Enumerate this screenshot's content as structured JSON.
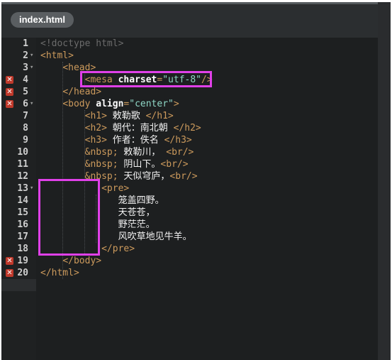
{
  "tab": {
    "label": "index.html"
  },
  "lines": [
    {
      "num": "1",
      "fold": "",
      "error": false
    },
    {
      "num": "2",
      "fold": "▾",
      "error": false
    },
    {
      "num": "3",
      "fold": "▾",
      "error": false
    },
    {
      "num": "4",
      "fold": "",
      "error": true
    },
    {
      "num": "5",
      "fold": "",
      "error": true
    },
    {
      "num": "6",
      "fold": "▾",
      "error": true
    },
    {
      "num": "7",
      "fold": "",
      "error": false
    },
    {
      "num": "8",
      "fold": "",
      "error": false
    },
    {
      "num": "9",
      "fold": "",
      "error": false
    },
    {
      "num": "10",
      "fold": "",
      "error": false
    },
    {
      "num": "11",
      "fold": "",
      "error": false
    },
    {
      "num": "12",
      "fold": "",
      "error": false
    },
    {
      "num": "13",
      "fold": "▾",
      "error": false
    },
    {
      "num": "14",
      "fold": "",
      "error": false
    },
    {
      "num": "15",
      "fold": "",
      "error": false
    },
    {
      "num": "16",
      "fold": "",
      "error": false
    },
    {
      "num": "17",
      "fold": "",
      "error": false
    },
    {
      "num": "18",
      "fold": "",
      "error": false
    },
    {
      "num": "19",
      "fold": "",
      "error": true
    },
    {
      "num": "20",
      "fold": "",
      "error": true
    }
  ],
  "error_marker": "✕",
  "code": {
    "l1": "<!doctype html>",
    "l2": "<html>",
    "l3": "<head>",
    "l4a": "<mesa ",
    "l4b": "charset",
    "l4c": "=",
    "l4d": "\"utf-8\"",
    "l4e": "/>",
    "l5": "</head>",
    "l6a": "<body ",
    "l6b": "align",
    "l6c": "=",
    "l6d": "\"center\"",
    "l6e": ">",
    "l7a": "<h1>",
    "l7b": " 敕勒歌 ",
    "l7c": "</h1>",
    "l8a": "<h2>",
    "l8b": " 朝代：南北朝 ",
    "l8c": "</h2>",
    "l9a": "<h3>",
    "l9b": " 作者：佚名 ",
    "l9c": "</h3>",
    "l10a": "&nbsp;",
    "l10b": " 敕勒川， ",
    "l10c": "<br/>",
    "l11a": "&nbsp;",
    "l11b": " 阴山下。",
    "l11c": "<br/>",
    "l12a": "&nbsp;",
    "l12b": " 天似穹庐，",
    "l12c": "<br/>",
    "l13": "<pre>",
    "l14": "笼盖四野。",
    "l15": "天苍苍，",
    "l16": "野茫茫。",
    "l17": "风吹草地见牛羊。",
    "l18": "</pre>",
    "l19": "</body>",
    "l20": "</html>"
  }
}
